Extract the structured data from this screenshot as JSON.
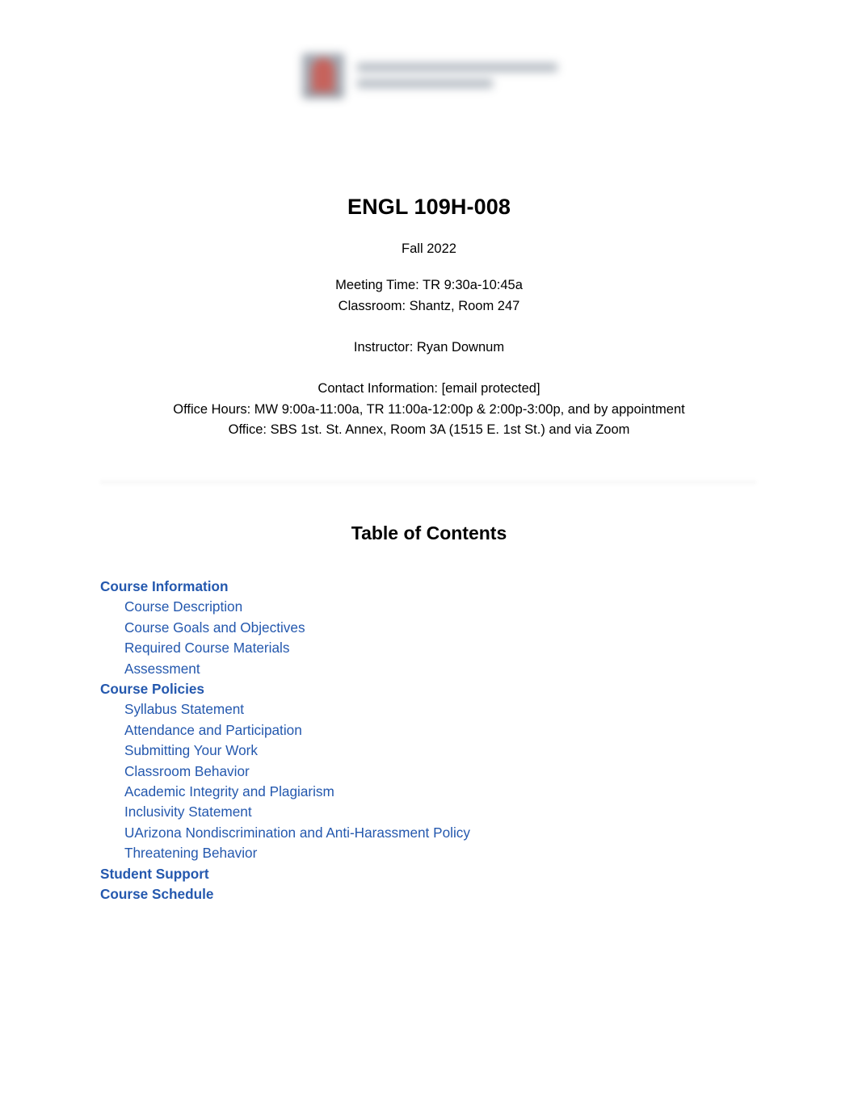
{
  "header": {
    "logo": {
      "mark_icon": "university-shield-logo-icon",
      "wordmark_icon": "university-wordmark-blurred-icon",
      "redacted": true
    }
  },
  "title": {
    "course_code": "ENGL 109H-008",
    "term": "Fall 2022"
  },
  "course_info": {
    "meeting_time": "Meeting Time: TR 9:30a-10:45a",
    "classroom": "Classroom: Shantz, Room 247",
    "instructor": "Instructor: Ryan Downum",
    "contact": "Contact Information: [email protected]",
    "office_hours": "Office Hours: MW 9:00a-11:00a, TR 11:00a-12:00p & 2:00p-3:00p, and by appointment",
    "office": "Office: SBS 1st. St. Annex, Room 3A (1515 E. 1st St.) and via Zoom"
  },
  "toc": {
    "heading": "Table of Contents",
    "link_color": "#2458AE",
    "items": [
      {
        "label": "Course Information",
        "level": 1
      },
      {
        "label": "Course Description",
        "level": 2
      },
      {
        "label": "Course Goals and Objectives",
        "level": 2
      },
      {
        "label": "Required Course Materials",
        "level": 2
      },
      {
        "label": "Assessment",
        "level": 2
      },
      {
        "label": "Course Policies",
        "level": 1
      },
      {
        "label": "Syllabus Statement",
        "level": 2
      },
      {
        "label": "Attendance and Participation",
        "level": 2
      },
      {
        "label": "Submitting Your Work",
        "level": 2
      },
      {
        "label": "Classroom Behavior",
        "level": 2
      },
      {
        "label": "Academic Integrity and Plagiarism",
        "level": 2
      },
      {
        "label": "Inclusivity Statement",
        "level": 2
      },
      {
        "label": "UArizona Nondiscrimination and Anti-Harassment Policy",
        "level": 2
      },
      {
        "label": "Threatening Behavior",
        "level": 2
      },
      {
        "label": "Student Support",
        "level": 1
      },
      {
        "label": "Course Schedule",
        "level": 1
      }
    ]
  }
}
